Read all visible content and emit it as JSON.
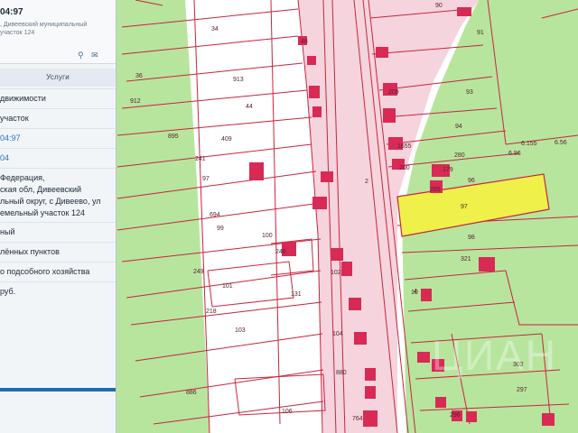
{
  "panel": {
    "title": "04:97",
    "subtitle_1": ", Дивеевский муниципальный",
    "subtitle_2": "участок 124",
    "tools": {
      "a": "⚲",
      "b": "✉"
    },
    "services_header": "Услуги",
    "rows": [
      {
        "lines": [
          "движимости"
        ]
      },
      {
        "lines": [
          "участок"
        ]
      },
      {
        "lines": [
          "04:97"
        ],
        "link": true
      },
      {
        "lines": [
          "04"
        ],
        "link": true
      },
      {
        "lines": [
          "Федерация,",
          "ская обл, Дивеевский",
          "льный округ, с Дивеево, ул",
          "емельный участок 124"
        ]
      },
      {
        "lines": [
          "ный"
        ]
      },
      {
        "lines": [
          "лённых пунктов"
        ]
      },
      {
        "lines": [
          "о подсобного хозяйства"
        ]
      },
      {
        "lines": [
          "руб."
        ]
      }
    ]
  },
  "map": {
    "colors": {
      "green": "#b7e59e",
      "pink": "#f6d4dd",
      "parcel_line": "#c8243f",
      "highlight": "#f0f04a",
      "label": "#5a2130",
      "building": "#d82a55"
    },
    "labels": {
      "l34": "34",
      "l48": "48",
      "l36": "36",
      "l913": "913",
      "l44": "44",
      "l912": "912",
      "l895": "895",
      "l409": "409",
      "l241": "241",
      "l97": "97",
      "l694": "694",
      "l99": "99",
      "l100": "100",
      "l248": "248",
      "l249": "249",
      "l101": "101",
      "l131": "131",
      "l218": "218",
      "l103": "103",
      "l104": "104",
      "l886": "886",
      "l880": "880",
      "l106": "106",
      "l764": "764",
      "l2": "2",
      "l4": "4",
      "l102": "102",
      "l90": "90",
      "l91": "91",
      "l93": "93",
      "l94": "94",
      "l280": "280",
      "l96": "96",
      "l97b": "97",
      "l98": "98",
      "l321": "321",
      "l10": "10",
      "l302": "302",
      "l297": "297",
      "l296": "296",
      "l6155": "6.155",
      "l656": "6.56",
      "l696": "6.96",
      "l179": "179",
      "l1655": "1655",
      "l200": "200",
      "l265": "265",
      "l209": "209"
    },
    "watermark": "ЦИАН"
  }
}
